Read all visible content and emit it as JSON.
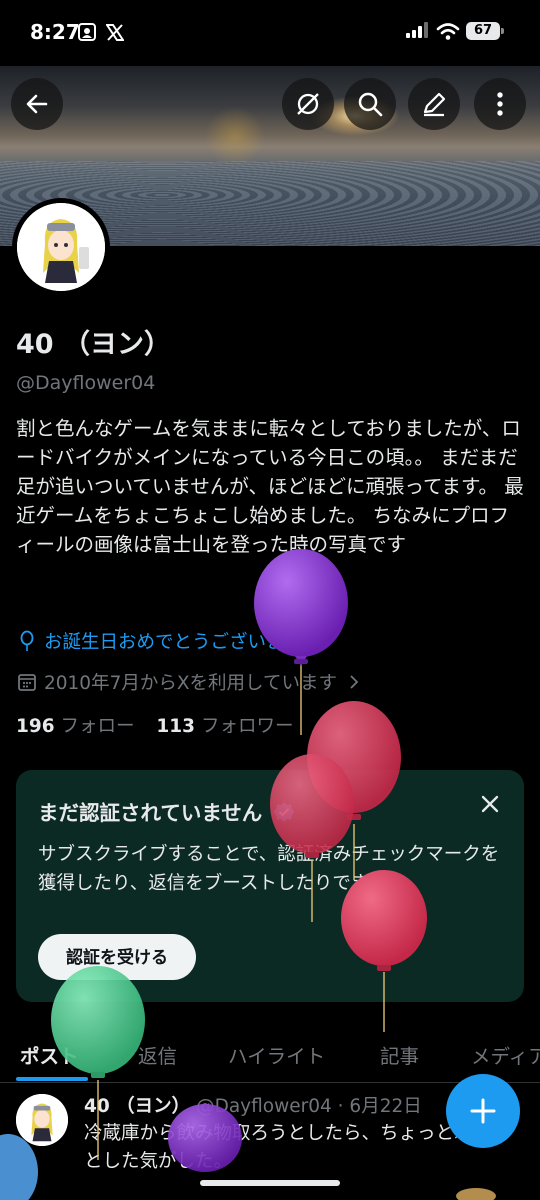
{
  "status_bar": {
    "time": "8:27",
    "battery": "67"
  },
  "profile": {
    "name": "40 （ヨン）",
    "handle": "@Dayflower04",
    "bio": "割と色んなゲームを気ままに転々としておりましたが、ロードバイクがメインになっている今日この頃。。 まだまだ足が追いついていませんが、ほどほどに頑張ってます。 最近ゲームをちょこちょこし始めました。 ちなみにプロフィールの画像は富士山を登った時の写真です",
    "birthday_text": "お誕生日おめでとうございます。",
    "joined_text": "2010年7月からXを利用しています",
    "following_count": "196",
    "following_label": "フォロー",
    "followers_count": "113",
    "followers_label": "フォロワー"
  },
  "verify_card": {
    "title": "まだ認証されていません",
    "body": "サブスクライブすることで、認証済みチェックマークを獲得したり、返信をブーストしたりできます。",
    "button": "認証を受ける"
  },
  "tabs": [
    {
      "label": "ポスト",
      "active": true
    },
    {
      "label": "返信"
    },
    {
      "label": "ハイライト"
    },
    {
      "label": "記事"
    },
    {
      "label": "メディア"
    }
  ],
  "post": {
    "name": "40 （ヨン）",
    "handle": "@Dayflower04",
    "separator": "·",
    "date": "6月22日",
    "text": "冷蔵庫から飲み物取ろうとしたら、ちょっとふらっとした気がした。"
  },
  "icons": {
    "back": "arrow-left-icon",
    "mute": "circle-slash-icon",
    "search": "search-icon",
    "edit": "pencil-icon",
    "more": "more-vertical-icon",
    "birthday": "balloon-icon",
    "joined": "calendar-icon",
    "verified": "verified-badge-icon",
    "close": "close-icon",
    "compose": "plus-icon"
  },
  "colors": {
    "accent": "#1d9bf0",
    "card_bg": "#0b2a24",
    "secondary_text": "#71767b",
    "balloon_purple": "#7b2bc4",
    "balloon_red": "#d43a5a",
    "balloon_green": "#44c88a"
  }
}
